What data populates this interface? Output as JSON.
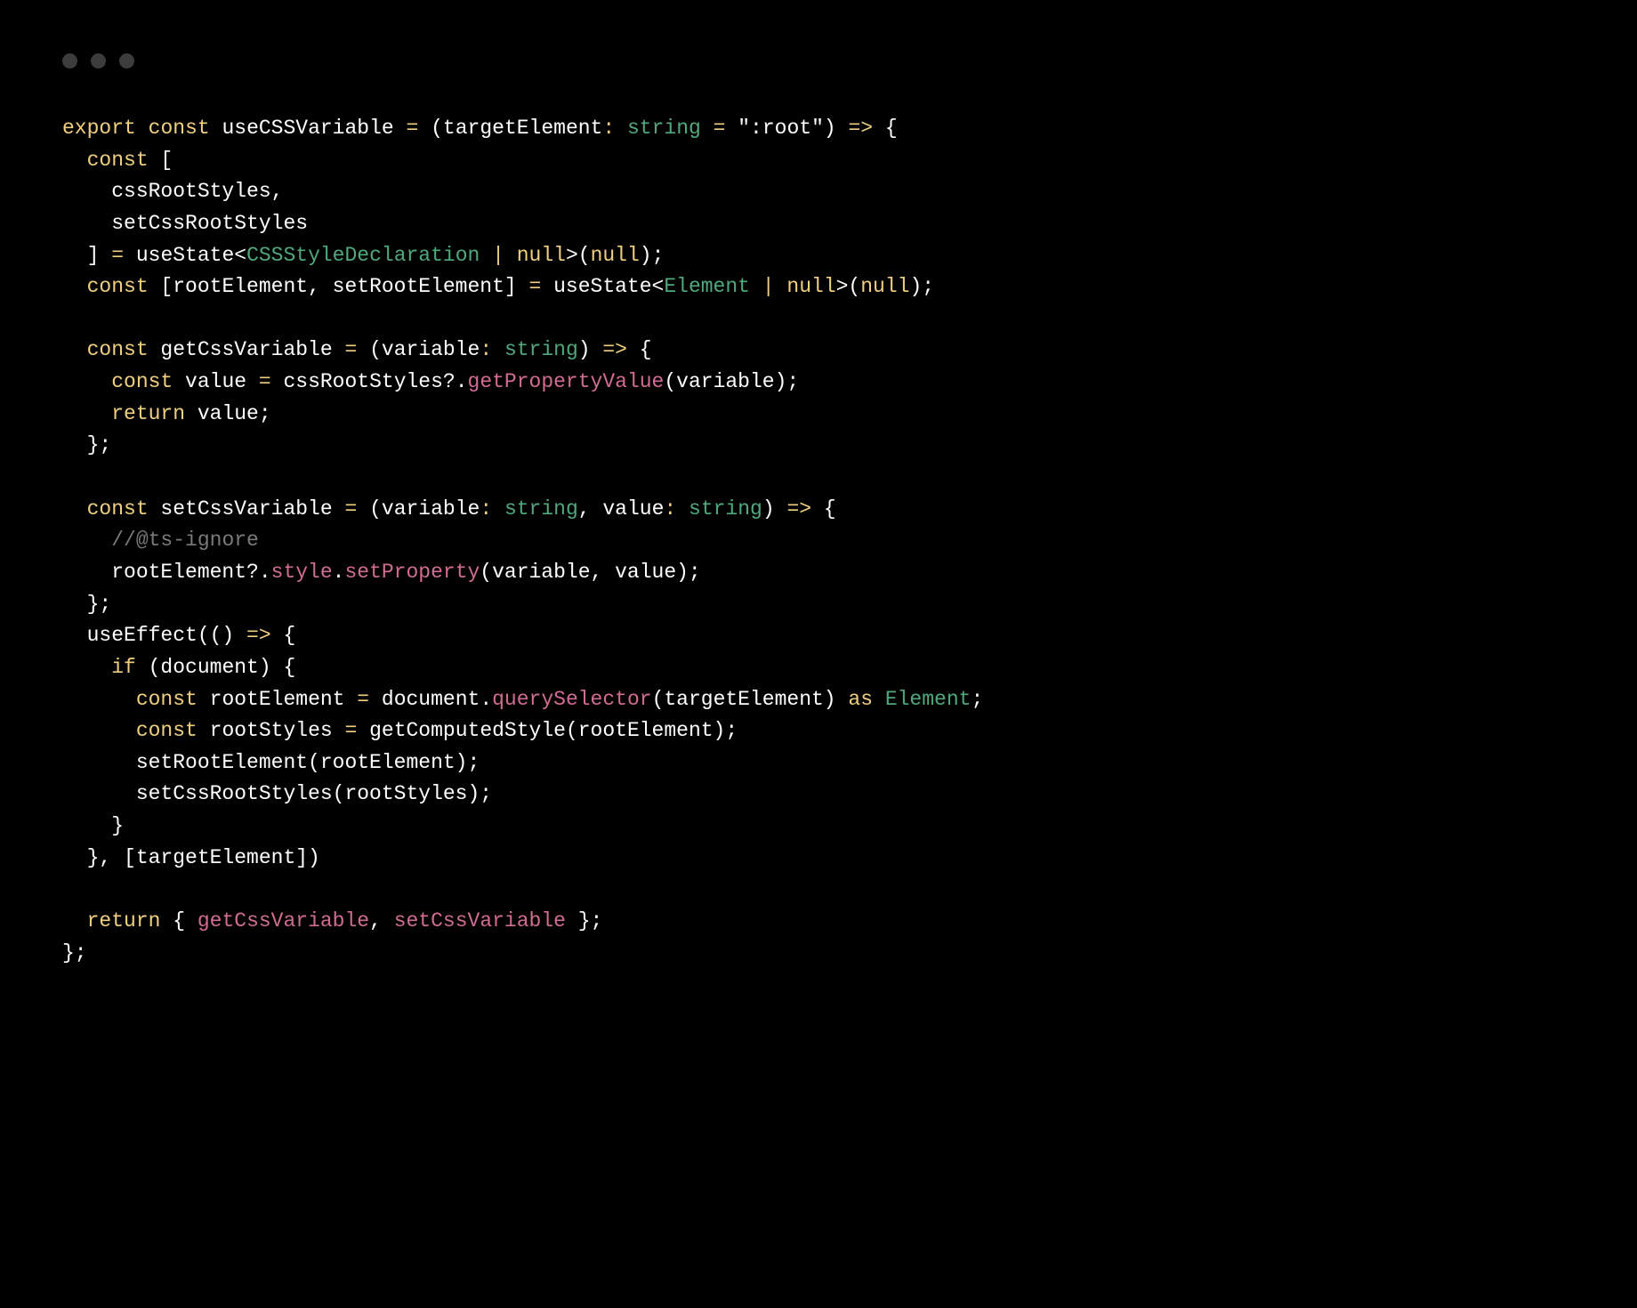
{
  "colors": {
    "background": "#000000",
    "traffic_dot": "#3c3c3c",
    "default": "#ffffff",
    "keyword": "#f0d080",
    "type": "#4fa97d",
    "function": "#d16d92",
    "comment": "#7a7a7a"
  },
  "code_tokens": [
    [
      {
        "c": "kw",
        "t": "export"
      },
      {
        "c": "pl",
        "t": " "
      },
      {
        "c": "kw",
        "t": "const"
      },
      {
        "c": "pl",
        "t": " useCSSVariable "
      },
      {
        "c": "kw",
        "t": "="
      },
      {
        "c": "pl",
        "t": " (targetElement"
      },
      {
        "c": "kw",
        "t": ":"
      },
      {
        "c": "pl",
        "t": " "
      },
      {
        "c": "ty",
        "t": "string"
      },
      {
        "c": "pl",
        "t": " "
      },
      {
        "c": "kw",
        "t": "="
      },
      {
        "c": "pl",
        "t": " "
      },
      {
        "c": "str",
        "t": "\":root\""
      },
      {
        "c": "pl",
        "t": ") "
      },
      {
        "c": "kw",
        "t": "=>"
      },
      {
        "c": "pl",
        "t": " {"
      }
    ],
    [
      {
        "c": "pl",
        "t": "  "
      },
      {
        "c": "kw",
        "t": "const"
      },
      {
        "c": "pl",
        "t": " ["
      }
    ],
    [
      {
        "c": "pl",
        "t": "    cssRootStyles,"
      }
    ],
    [
      {
        "c": "pl",
        "t": "    setCssRootStyles"
      }
    ],
    [
      {
        "c": "pl",
        "t": "  ] "
      },
      {
        "c": "kw",
        "t": "="
      },
      {
        "c": "pl",
        "t": " useState<"
      },
      {
        "c": "ty",
        "t": "CSSStyleDeclaration"
      },
      {
        "c": "pl",
        "t": " "
      },
      {
        "c": "kw",
        "t": "|"
      },
      {
        "c": "pl",
        "t": " "
      },
      {
        "c": "kw",
        "t": "null"
      },
      {
        "c": "pl",
        "t": ">("
      },
      {
        "c": "kw",
        "t": "null"
      },
      {
        "c": "pl",
        "t": ");"
      }
    ],
    [
      {
        "c": "pl",
        "t": "  "
      },
      {
        "c": "kw",
        "t": "const"
      },
      {
        "c": "pl",
        "t": " [rootElement, setRootElement] "
      },
      {
        "c": "kw",
        "t": "="
      },
      {
        "c": "pl",
        "t": " useState<"
      },
      {
        "c": "ty",
        "t": "Element"
      },
      {
        "c": "pl",
        "t": " "
      },
      {
        "c": "kw",
        "t": "|"
      },
      {
        "c": "pl",
        "t": " "
      },
      {
        "c": "kw",
        "t": "null"
      },
      {
        "c": "pl",
        "t": ">("
      },
      {
        "c": "kw",
        "t": "null"
      },
      {
        "c": "pl",
        "t": ");"
      }
    ],
    [
      {
        "c": "pl",
        "t": ""
      }
    ],
    [
      {
        "c": "pl",
        "t": "  "
      },
      {
        "c": "kw",
        "t": "const"
      },
      {
        "c": "pl",
        "t": " getCssVariable "
      },
      {
        "c": "kw",
        "t": "="
      },
      {
        "c": "pl",
        "t": " (variable"
      },
      {
        "c": "kw",
        "t": ":"
      },
      {
        "c": "pl",
        "t": " "
      },
      {
        "c": "ty",
        "t": "string"
      },
      {
        "c": "pl",
        "t": ") "
      },
      {
        "c": "kw",
        "t": "=>"
      },
      {
        "c": "pl",
        "t": " {"
      }
    ],
    [
      {
        "c": "pl",
        "t": "    "
      },
      {
        "c": "kw",
        "t": "const"
      },
      {
        "c": "pl",
        "t": " value "
      },
      {
        "c": "kw",
        "t": "="
      },
      {
        "c": "pl",
        "t": " cssRootStyles?."
      },
      {
        "c": "fn",
        "t": "getPropertyValue"
      },
      {
        "c": "pl",
        "t": "(variable);"
      }
    ],
    [
      {
        "c": "pl",
        "t": "    "
      },
      {
        "c": "kw",
        "t": "return"
      },
      {
        "c": "pl",
        "t": " value;"
      }
    ],
    [
      {
        "c": "pl",
        "t": "  };"
      }
    ],
    [
      {
        "c": "pl",
        "t": ""
      }
    ],
    [
      {
        "c": "pl",
        "t": "  "
      },
      {
        "c": "kw",
        "t": "const"
      },
      {
        "c": "pl",
        "t": " setCssVariable "
      },
      {
        "c": "kw",
        "t": "="
      },
      {
        "c": "pl",
        "t": " (variable"
      },
      {
        "c": "kw",
        "t": ":"
      },
      {
        "c": "pl",
        "t": " "
      },
      {
        "c": "ty",
        "t": "string"
      },
      {
        "c": "pl",
        "t": ", value"
      },
      {
        "c": "kw",
        "t": ":"
      },
      {
        "c": "pl",
        "t": " "
      },
      {
        "c": "ty",
        "t": "string"
      },
      {
        "c": "pl",
        "t": ") "
      },
      {
        "c": "kw",
        "t": "=>"
      },
      {
        "c": "pl",
        "t": " {"
      }
    ],
    [
      {
        "c": "pl",
        "t": "    "
      },
      {
        "c": "cm",
        "t": "//@ts-ignore"
      }
    ],
    [
      {
        "c": "pl",
        "t": "    rootElement?."
      },
      {
        "c": "fn",
        "t": "style"
      },
      {
        "c": "pl",
        "t": "."
      },
      {
        "c": "fn",
        "t": "setProperty"
      },
      {
        "c": "pl",
        "t": "(variable, value);"
      }
    ],
    [
      {
        "c": "pl",
        "t": "  };"
      }
    ],
    [
      {
        "c": "pl",
        "t": "  useEffect(() "
      },
      {
        "c": "kw",
        "t": "=>"
      },
      {
        "c": "pl",
        "t": " {"
      }
    ],
    [
      {
        "c": "pl",
        "t": "    "
      },
      {
        "c": "kw",
        "t": "if"
      },
      {
        "c": "pl",
        "t": " (document) {"
      }
    ],
    [
      {
        "c": "pl",
        "t": "      "
      },
      {
        "c": "kw",
        "t": "const"
      },
      {
        "c": "pl",
        "t": " rootElement "
      },
      {
        "c": "kw",
        "t": "="
      },
      {
        "c": "pl",
        "t": " document."
      },
      {
        "c": "fn",
        "t": "querySelector"
      },
      {
        "c": "pl",
        "t": "(targetElement) "
      },
      {
        "c": "kw",
        "t": "as"
      },
      {
        "c": "pl",
        "t": " "
      },
      {
        "c": "ty",
        "t": "Element"
      },
      {
        "c": "pl",
        "t": ";"
      }
    ],
    [
      {
        "c": "pl",
        "t": "      "
      },
      {
        "c": "kw",
        "t": "const"
      },
      {
        "c": "pl",
        "t": " rootStyles "
      },
      {
        "c": "kw",
        "t": "="
      },
      {
        "c": "pl",
        "t": " getComputedStyle(rootElement);"
      }
    ],
    [
      {
        "c": "pl",
        "t": "      setRootElement(rootElement);"
      }
    ],
    [
      {
        "c": "pl",
        "t": "      setCssRootStyles(rootStyles);"
      }
    ],
    [
      {
        "c": "pl",
        "t": "    }"
      }
    ],
    [
      {
        "c": "pl",
        "t": "  }, [targetElement])"
      }
    ],
    [
      {
        "c": "pl",
        "t": ""
      }
    ],
    [
      {
        "c": "pl",
        "t": "  "
      },
      {
        "c": "kw",
        "t": "return"
      },
      {
        "c": "pl",
        "t": " { "
      },
      {
        "c": "fn",
        "t": "getCssVariable"
      },
      {
        "c": "pl",
        "t": ", "
      },
      {
        "c": "fn",
        "t": "setCssVariable"
      },
      {
        "c": "pl",
        "t": " };"
      }
    ],
    [
      {
        "c": "pl",
        "t": "};"
      }
    ]
  ]
}
